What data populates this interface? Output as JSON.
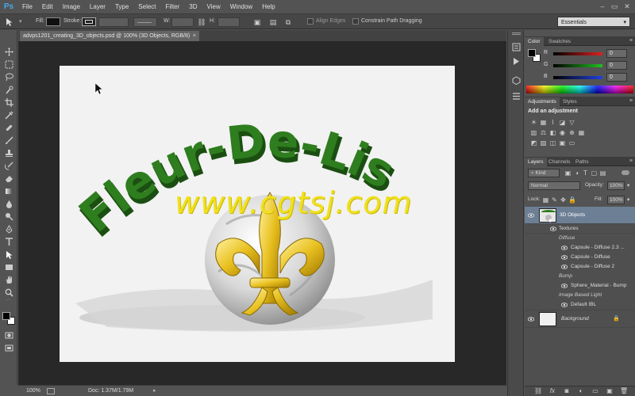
{
  "app": {
    "logo": "Ps"
  },
  "menu": [
    "File",
    "Edit",
    "Image",
    "Layer",
    "Type",
    "Select",
    "Filter",
    "3D",
    "View",
    "Window",
    "Help"
  ],
  "options": {
    "fill_label": "Fill:",
    "stroke_label": "Stroke:",
    "w_label": "W:",
    "h_label": "H:",
    "align_edges": "Align Edges",
    "constrain": "Constrain Path Dragging",
    "workspace": "Essentials"
  },
  "document": {
    "tab_title": "advps1201_creating_3D_objects.psd @ 100% (3D Objects, RGB/8)",
    "close": "×",
    "overlay_text": "www.cgtsj.com",
    "artwork": {
      "arc_text": "Fleur-De-Lis",
      "colors": {
        "arc_text": "#2e7d1e",
        "fleur": "#e8c020",
        "sphere": "#c8c8c8"
      }
    }
  },
  "status": {
    "zoom": "100%",
    "doc": "Doc: 1.37M/1.79M"
  },
  "color_panel": {
    "tabs": [
      "Color",
      "Swatches"
    ],
    "channels": [
      {
        "label": "R",
        "value": "0",
        "color": "#e02020"
      },
      {
        "label": "G",
        "value": "0",
        "color": "#20c020"
      },
      {
        "label": "B",
        "value": "0",
        "color": "#2040e0"
      }
    ]
  },
  "adjustments_panel": {
    "tabs": [
      "Adjustments",
      "Styles"
    ],
    "heading": "Add an adjustment"
  },
  "layers_panel": {
    "tabs": [
      "Layers",
      "Channels",
      "Paths"
    ],
    "kind": "Kind",
    "blend_mode": "Normal",
    "opacity_label": "Opacity:",
    "opacity_value": "100%",
    "lock_label": "Lock:",
    "fill_label": "Fill:",
    "fill_value": "100%",
    "layers": [
      {
        "name": "3D Objects",
        "type": "3d",
        "selected": true
      },
      {
        "name": "Textures",
        "type": "group"
      },
      {
        "name": "Diffuse",
        "type": "section"
      },
      {
        "name": "Capsule - Diffuse 2.3 ...",
        "type": "item"
      },
      {
        "name": "Capsule - Diffuse",
        "type": "item"
      },
      {
        "name": "Capsule - Diffuse 2",
        "type": "item"
      },
      {
        "name": "Bump",
        "type": "section"
      },
      {
        "name": "Sphere_Material - Bump",
        "type": "item"
      },
      {
        "name": "Image Based Light",
        "type": "section"
      },
      {
        "name": "Default IBL",
        "type": "item"
      },
      {
        "name": "Background",
        "type": "background"
      }
    ],
    "footer_fx": "fx"
  }
}
